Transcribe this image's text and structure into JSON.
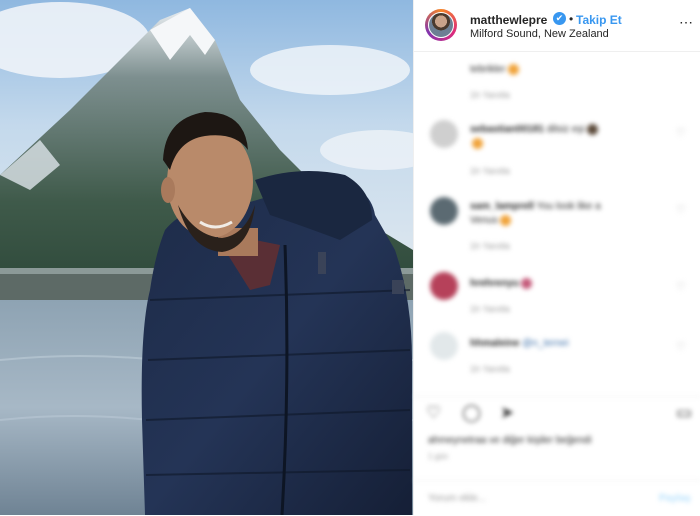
{
  "post": {
    "username": "matthewlepre",
    "follow_label": "Takip Et",
    "separator": "•",
    "location": "Milford Sound, New Zealand",
    "more_icon": "⋯",
    "verified_icon": "✔",
    "photo_description_icon": "photo"
  },
  "comments": [
    {
      "user": "",
      "text": "tebrikler",
      "meta": "1h  Yanıtla",
      "avatar_color": "#ffffff"
    },
    {
      "user": "sebastian00181",
      "text": "dilsiz eşi",
      "meta": "1h  Yanıtla",
      "avatar_color": "#cfcfcf"
    },
    {
      "user": "sam_lamprell",
      "text": "You look like a",
      "text2": "Venus",
      "meta": "1h  Yanıtla",
      "avatar_color": "#5b6a72"
    },
    {
      "user": "hrehrenyu",
      "text": "",
      "meta": "1h  Yanıtla",
      "avatar_color": "#b6415a"
    },
    {
      "user": "hhmaleine",
      "text": "@n_ternei",
      "meta": "1h  Yanıtla",
      "avatar_color": "#e2e8ea"
    }
  ],
  "actions": {
    "like_icon": "♡",
    "comment_icon": "◯",
    "share_icon": "➤",
    "save_icon": "▭"
  },
  "likes_text": "ahmeynetraa ve diğer kişiler beğendi",
  "date_text": "1 gün",
  "add_comment_placeholder": "Yorum ekle...",
  "post_button": "Paylaş",
  "colors": {
    "accent": "#3897f0",
    "text": "#262626",
    "muted": "#9a9a9a",
    "border": "#efefef"
  }
}
